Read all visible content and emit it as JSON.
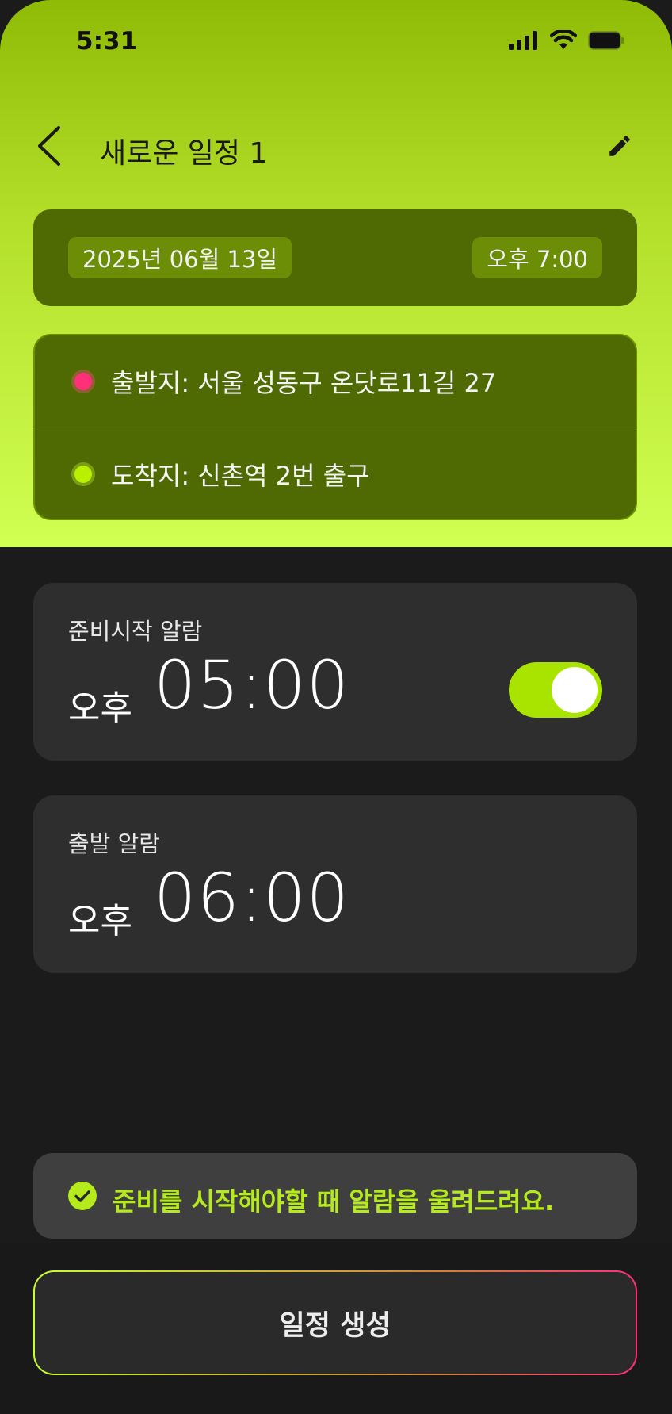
{
  "status_bar": {
    "time": "5:31"
  },
  "header": {
    "title": "새로운 일정 1"
  },
  "schedule": {
    "date": "2025년 06월 13일",
    "time": "오후 7:00"
  },
  "route": {
    "start": "출발지: 서울 성동구 온닷로11길 27",
    "end": "도착지: 신촌역 2번 출구"
  },
  "alarms": [
    {
      "label": "준비시작 알람",
      "ampm": "오후",
      "time": "05:00",
      "toggle_on": true
    },
    {
      "label": "출발 알람",
      "ampm": "오후",
      "time": "06:00"
    }
  ],
  "info": {
    "text": "준비를 시작해야할 때 알람을 울려드려요."
  },
  "create_button": {
    "label": "일정 생성"
  },
  "colors": {
    "accent": "#a9e400",
    "card_green": "#4f6a02",
    "start_dot": "#ff2f78",
    "end_dot": "#b8f000",
    "info_text": "#b5ea1c"
  },
  "icons": {
    "back": "chevron-left-icon",
    "edit": "pencil-icon",
    "signal": "signal-icon",
    "wifi": "wifi-icon",
    "battery": "battery-icon",
    "check": "check-circle-icon"
  }
}
